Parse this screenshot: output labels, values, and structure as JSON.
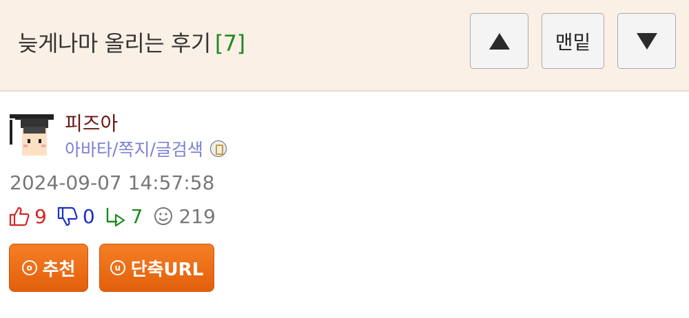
{
  "header": {
    "title": "늦게나마 올리는 후기",
    "comment_count": "[7]",
    "bottom_label": "맨밑"
  },
  "author": {
    "nickname": "피즈아",
    "links": [
      "아바타",
      "쪽지",
      "글검색"
    ]
  },
  "post": {
    "datetime": "2024-09-07 14:57:58",
    "upvotes": "9",
    "downvotes": "0",
    "replies": "7",
    "views": "219"
  },
  "actions": {
    "recommend_label": "추천",
    "recommend_icon_letter": "o",
    "shorturl_label": "단축URL",
    "shorturl_icon_letter": "u"
  },
  "colors": {
    "header_bg": "#fbf0e6",
    "count_green": "#1f8a1f",
    "nick": "#6b1414",
    "links": "#7b7fd6",
    "action_orange": "#ed6d17"
  }
}
